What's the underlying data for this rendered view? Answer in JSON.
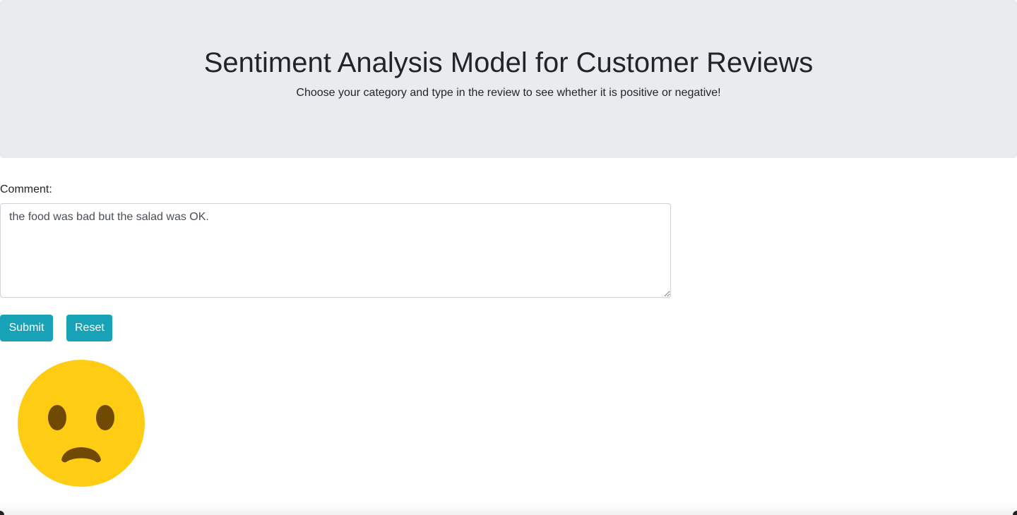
{
  "header": {
    "title": "Sentiment Analysis Model for Customer Reviews",
    "subtitle": "Choose your category and type in the review to see whether it is positive or negative!"
  },
  "form": {
    "comment_label": "Comment:",
    "comment_value": "the food was bad but the salad was OK.",
    "submit_label": "Submit",
    "reset_label": "Reset"
  },
  "result": {
    "icon": "sad-face-icon",
    "face_color": "#ffcc14",
    "feature_color": "#704a02"
  },
  "colors": {
    "header_bg": "#e9ecef",
    "button_bg": "#17a2b8",
    "text": "#212529"
  }
}
